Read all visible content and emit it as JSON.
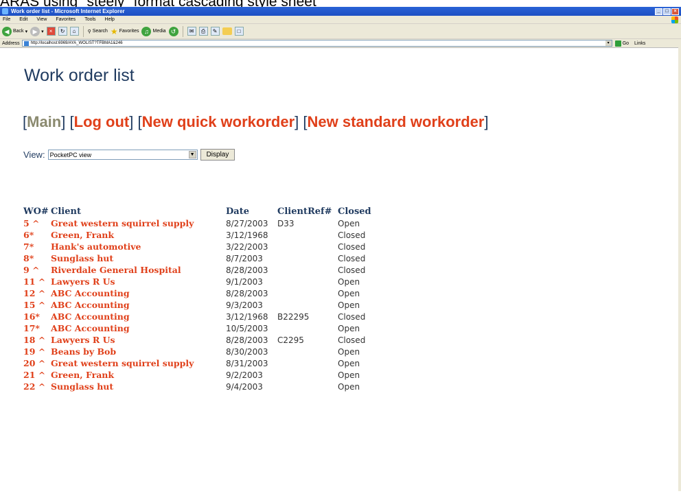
{
  "document_caption": "ARAS using \"steely\" format cascading style sheet",
  "window": {
    "title": "Work order list - Microsoft Internet Explorer",
    "controls": [
      "_",
      "□",
      "×"
    ]
  },
  "menu": [
    "File",
    "Edit",
    "View",
    "Favorites",
    "Tools",
    "Help"
  ],
  "toolbar": {
    "back": "Back",
    "search": "Search",
    "favorites": "Favorites",
    "media": "Media"
  },
  "address": {
    "label": "Address",
    "url": "http://localhost:6969/AYA_WOLIST?TFBMA1&246",
    "go": "Go",
    "links": "Links"
  },
  "page": {
    "title": "Work order list",
    "nav": {
      "main": "Main",
      "logout": "Log out",
      "new_quick": "New quick workorder",
      "new_standard": "New standard workorder"
    },
    "view_label": "View:",
    "view_value": "PocketPC view",
    "display_button": "Display"
  },
  "table": {
    "headers": [
      "WO#",
      "Client",
      "Date",
      "ClientRef#",
      "Closed"
    ],
    "rows": [
      {
        "wo": "5 ^",
        "client": "Great western squirrel supply",
        "date": "8/27/2003",
        "ref": "D33",
        "closed": "Open"
      },
      {
        "wo": "6*",
        "client": "Green, Frank",
        "date": "3/12/1968",
        "ref": "",
        "closed": "Closed"
      },
      {
        "wo": "7*",
        "client": "Hank's automotive",
        "date": "3/22/2003",
        "ref": "",
        "closed": "Closed"
      },
      {
        "wo": "8*",
        "client": "Sunglass hut",
        "date": "8/7/2003",
        "ref": "",
        "closed": "Closed"
      },
      {
        "wo": "9 ^",
        "client": "Riverdale General Hospital",
        "date": "8/28/2003",
        "ref": "",
        "closed": "Closed"
      },
      {
        "wo": "11 ^",
        "client": "Lawyers R Us",
        "date": "9/1/2003",
        "ref": "",
        "closed": "Open"
      },
      {
        "wo": "12 ^",
        "client": "ABC Accounting",
        "date": "8/28/2003",
        "ref": "",
        "closed": "Open"
      },
      {
        "wo": "15 ^",
        "client": "ABC Accounting",
        "date": "9/3/2003",
        "ref": "",
        "closed": "Open"
      },
      {
        "wo": "16*",
        "client": "ABC Accounting",
        "date": "3/12/1968",
        "ref": "B22295",
        "closed": "Closed"
      },
      {
        "wo": "17*",
        "client": "ABC Accounting",
        "date": "10/5/2003",
        "ref": "",
        "closed": "Open"
      },
      {
        "wo": "18 ^",
        "client": "Lawyers R Us",
        "date": "8/28/2003",
        "ref": "C2295",
        "closed": "Closed"
      },
      {
        "wo": "19 ^",
        "client": "Beans by Bob",
        "date": "8/30/2003",
        "ref": "",
        "closed": "Open"
      },
      {
        "wo": "20 ^",
        "client": "Great western squirrel supply",
        "date": "8/31/2003",
        "ref": "",
        "closed": "Open"
      },
      {
        "wo": "21 ^",
        "client": "Green, Frank",
        "date": "9/2/2003",
        "ref": "",
        "closed": "Open"
      },
      {
        "wo": "22 ^",
        "client": "Sunglass hut",
        "date": "9/4/2003",
        "ref": "",
        "closed": "Open"
      }
    ]
  }
}
